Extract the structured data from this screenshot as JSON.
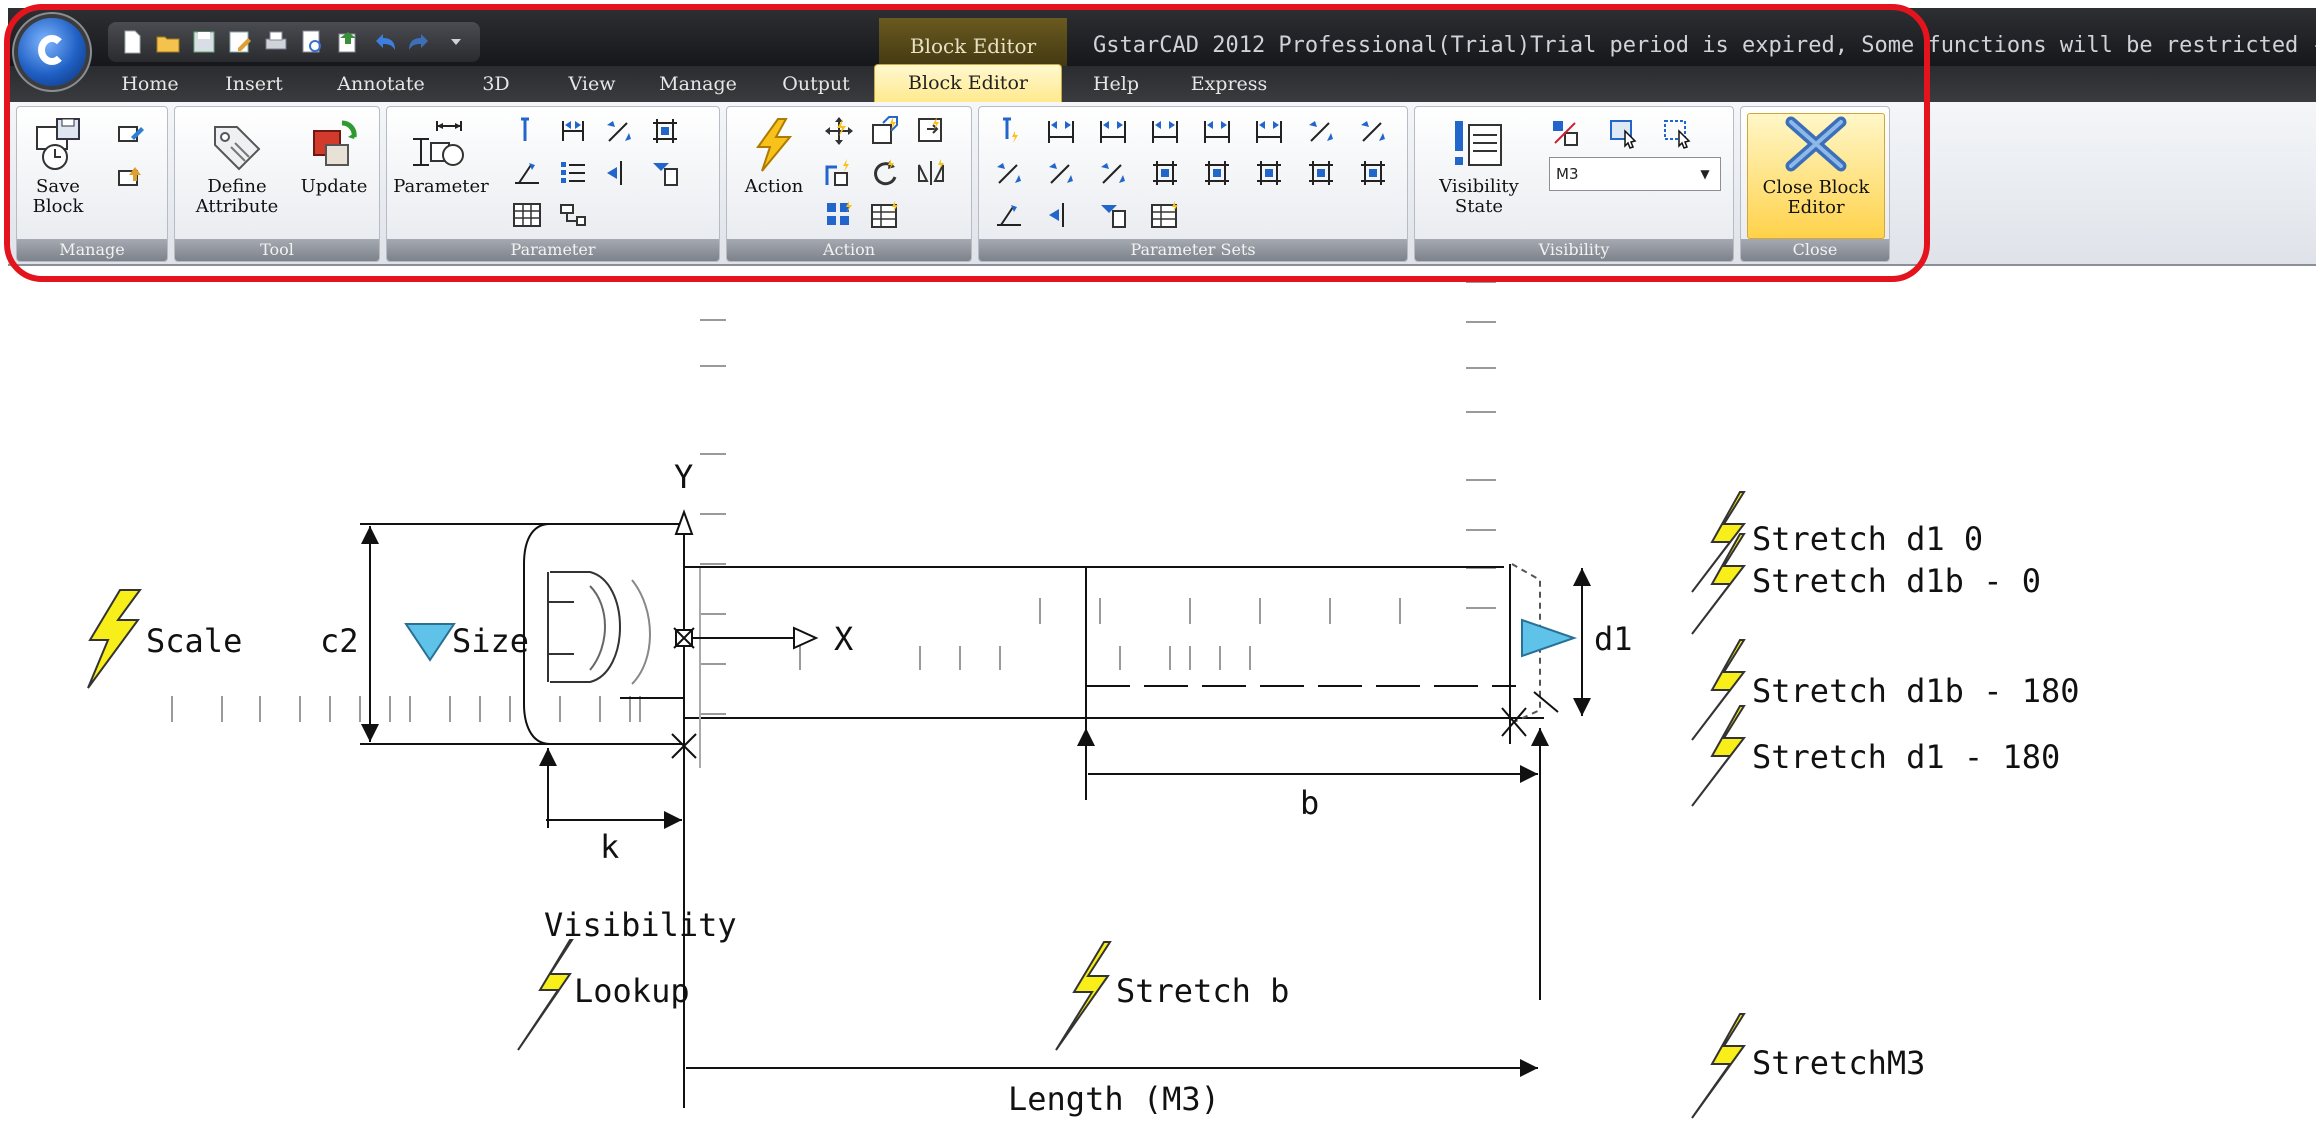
{
  "app": {
    "title": "GstarCAD 2012 Professional(Trial)Trial period is expired, Some functions will be restricted -",
    "context_tab_label": "Block Editor",
    "app_button_icon": "gstarcad-logo-icon"
  },
  "quick_access": [
    "new-icon",
    "open-icon",
    "save-icon",
    "save-as-icon",
    "print-icon",
    "preview-icon",
    "publish-icon",
    "undo-icon",
    "redo-icon",
    "customize-icon"
  ],
  "tabs": [
    {
      "label": "Home",
      "active": false
    },
    {
      "label": "Insert",
      "active": false
    },
    {
      "label": "Annotate",
      "active": false
    },
    {
      "label": "3D",
      "active": false
    },
    {
      "label": "View",
      "active": false
    },
    {
      "label": "Manage",
      "active": false
    },
    {
      "label": "Output",
      "active": false
    },
    {
      "label": "Block Editor",
      "active": true
    },
    {
      "label": "Help",
      "active": false
    },
    {
      "label": "Express",
      "active": false
    }
  ],
  "ribbon": {
    "manage": {
      "title": "Manage",
      "save_block": "Save\nBlock"
    },
    "tool": {
      "title": "Tool",
      "define_attribute": "Define\nAttribute",
      "update": "Update"
    },
    "parameter": {
      "title": "Parameter",
      "parameter": "Parameter"
    },
    "action": {
      "title": "Action",
      "action": "Action"
    },
    "parameter_sets": {
      "title": "Parameter Sets"
    },
    "visibility": {
      "title": "Visibility",
      "visibility_state": "Visibility\nState",
      "state_value": "M3"
    },
    "close": {
      "title": "Close",
      "close_block_editor": "Close Block\nEditor"
    }
  },
  "drawing": {
    "labels": {
      "scale": "Scale",
      "c2": "c2",
      "size": "Size",
      "y_axis": "Y",
      "x_axis": "X",
      "k": "k",
      "b": "b",
      "d1": "d1",
      "visibility": "Visibility",
      "lookup": "Lookup",
      "stretch_b": "Stretch b",
      "length": "Length (M3)",
      "stretch_d1_0": "Stretch d1  0",
      "stretch_d1b_0": "Stretch d1b - 0",
      "stretch_d1b_180": "Stretch d1b - 180",
      "stretch_d1_180": "Stretch d1 - 180",
      "stretch_m3": "StretchM3"
    },
    "colors": {
      "action_bolt": "#f7ee1a",
      "parameter_grip": "#5fc2e8",
      "line": "#111111",
      "highlight": "#e3141d"
    }
  }
}
